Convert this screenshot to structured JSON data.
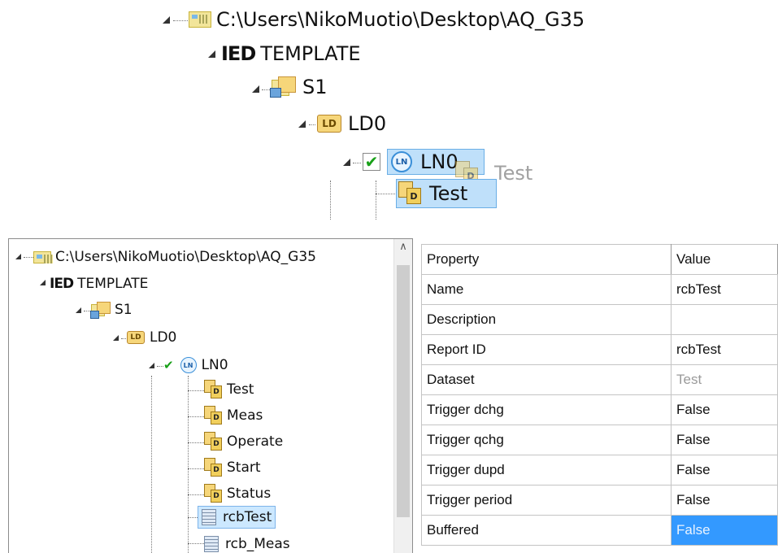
{
  "zoom_tree": {
    "root_path": "C:\\Users\\NikoMuotio\\Desktop\\AQ_G35",
    "ied_prefix": "IED",
    "ied": "TEMPLATE",
    "server": "S1",
    "ld": "LD0",
    "ln": "LN0",
    "dataset_selected": "Test",
    "drag_ghost": "Test",
    "ld_icon_text": "LD",
    "ln_icon_text": "LN",
    "ds_icon_text": "D"
  },
  "tree": {
    "root_path": "C:\\Users\\NikoMuotio\\Desktop\\AQ_G35",
    "ied_prefix": "IED",
    "ied": "TEMPLATE",
    "server": "S1",
    "ld": "LD0",
    "ln": "LN0",
    "datasets": [
      "Test",
      "Meas",
      "Operate",
      "Start",
      "Status"
    ],
    "reports": [
      "rcbTest",
      "rcb_Meas"
    ],
    "selected_report": "rcbTest"
  },
  "property_grid": {
    "headers": [
      "Property",
      "Value"
    ],
    "rows": [
      {
        "property": "Name",
        "value": "rcbTest"
      },
      {
        "property": "Description",
        "value": ""
      },
      {
        "property": "Report ID",
        "value": "rcbTest"
      },
      {
        "property": "Dataset",
        "value": "Test",
        "disabled": true
      },
      {
        "property": "Trigger dchg",
        "value": "False"
      },
      {
        "property": "Trigger qchg",
        "value": "False"
      },
      {
        "property": "Trigger dupd",
        "value": "False"
      },
      {
        "property": "Trigger period",
        "value": "False"
      },
      {
        "property": "Buffered",
        "value": "False",
        "selected": true
      }
    ],
    "selected_color": "#3399ff"
  }
}
